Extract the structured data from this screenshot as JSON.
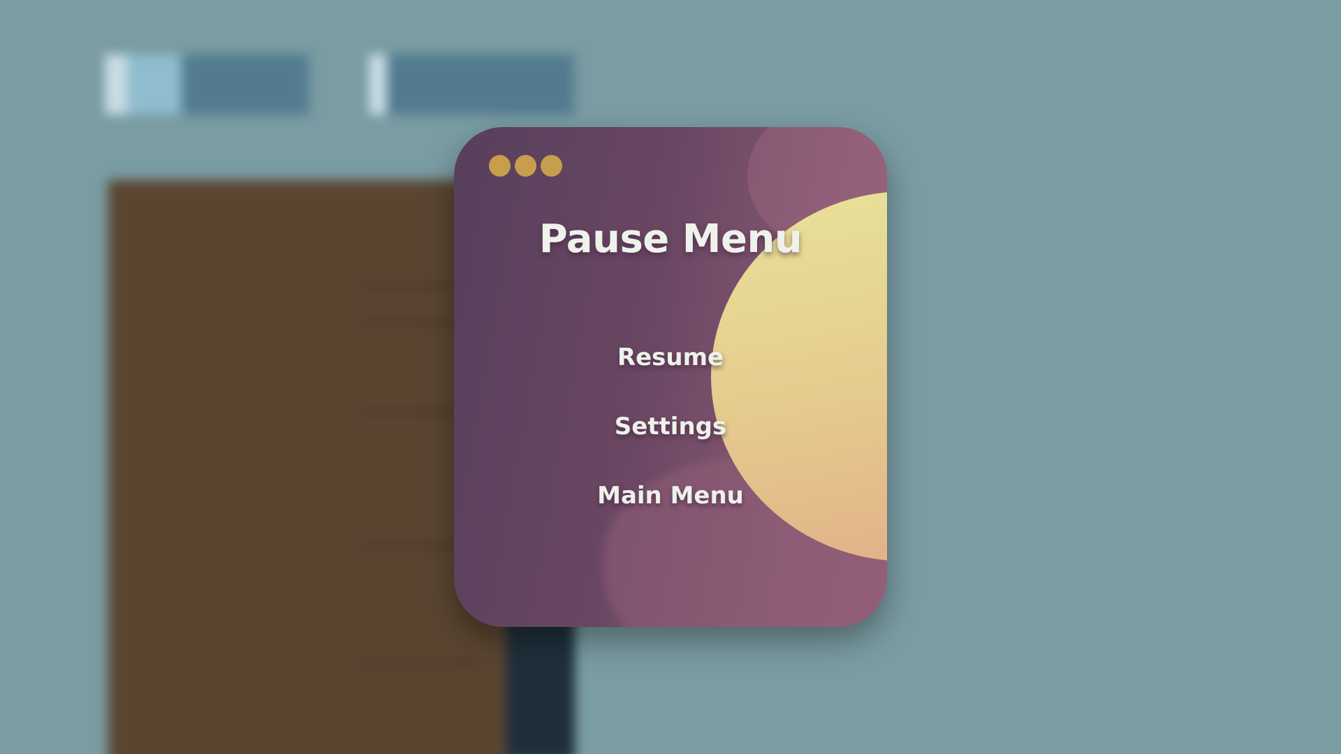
{
  "pause_menu": {
    "title": "Pause Menu",
    "options": [
      "Resume",
      "Settings",
      "Main Menu"
    ]
  },
  "colors": {
    "background": "#7a9ca3",
    "card_dark": "#573f5c",
    "card_light": "#955f76",
    "sun_top": "#e8e29a",
    "sun_bottom": "#e2ad88",
    "dots": "#c79f4c",
    "text": "#eef2ea"
  },
  "icons": {
    "more": "more-dots-icon"
  }
}
